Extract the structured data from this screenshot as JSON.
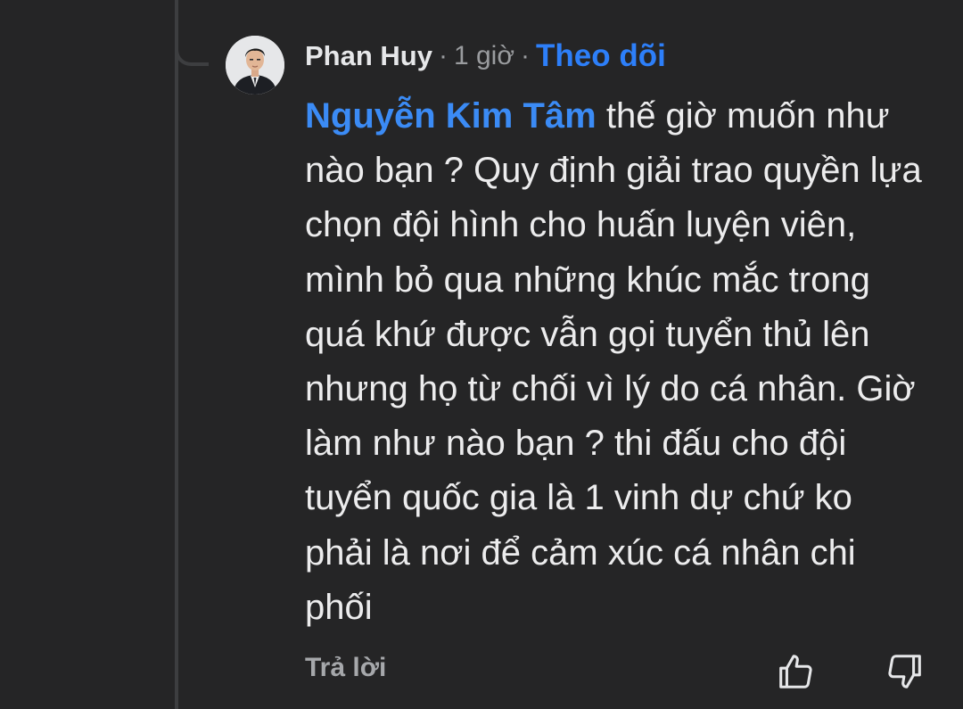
{
  "comment": {
    "author": "Phan Huy",
    "separator_1": "·",
    "time": "1 giờ",
    "separator_2": "·",
    "follow_label": "Theo dõi",
    "mention": "Nguyễn Kim Tâm",
    "body": " thế giờ muốn như nào bạn ? Quy định giải trao quyền lựa chọn đội hình cho huấn luyện viên, mình bỏ qua những khúc mắc trong quá khứ được vẫn gọi tuyển thủ lên nhưng họ từ chối vì lý do cá nhân. Giờ làm như nào bạn ? thi đấu cho đội tuyển quốc gia là 1 vinh dự chứ ko phải là nơi để cảm xúc cá nhân chi phối"
  },
  "actions": {
    "reply_label": "Trả lời",
    "like_icon": "thumbs-up-icon",
    "dislike_icon": "thumbs-down-icon"
  },
  "colors": {
    "background": "#252526",
    "thread_line": "#3d3e40",
    "link_blue": "#2d7ff9",
    "text": "#ececed",
    "muted": "#9a9c9f"
  }
}
